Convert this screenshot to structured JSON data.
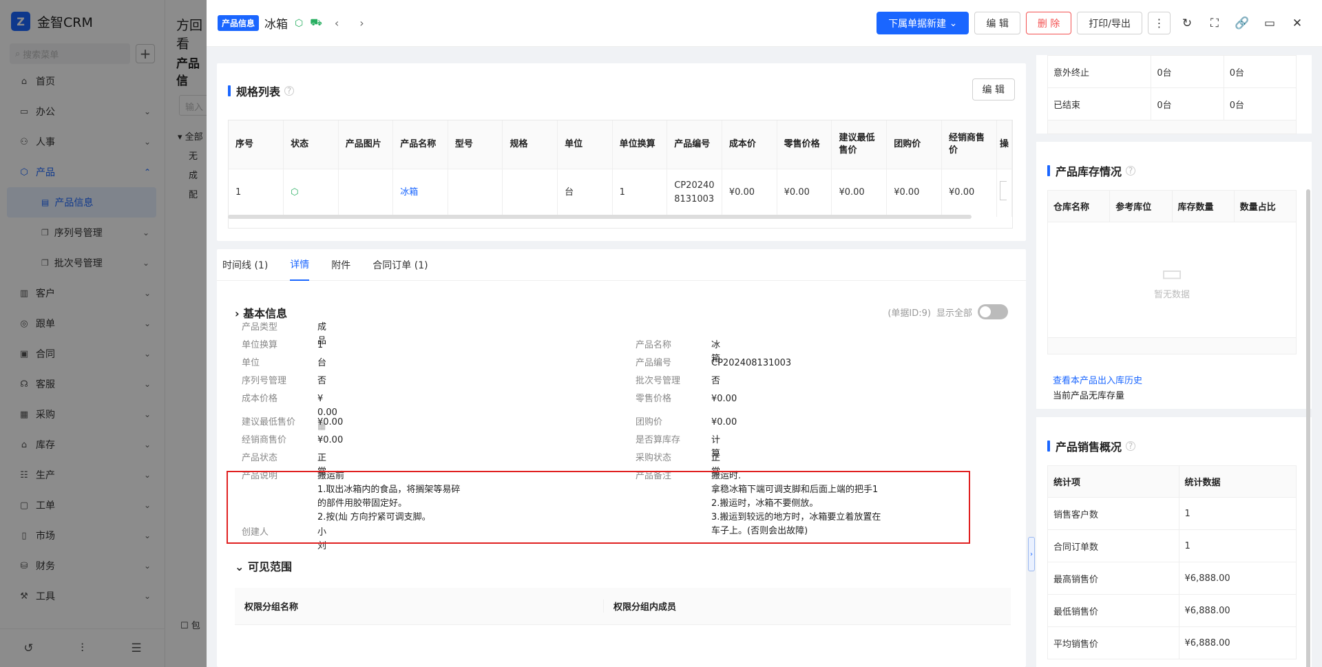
{
  "sidebar": {
    "app_name": "金智CRM",
    "search_placeholder": "搜索菜单",
    "items": [
      {
        "label": "首页",
        "icon": "home-icon"
      },
      {
        "label": "办公",
        "icon": "office-icon"
      },
      {
        "label": "人事",
        "icon": "people-icon"
      },
      {
        "label": "产品",
        "icon": "cube-icon"
      },
      {
        "label": "产品信息",
        "icon": "list-icon"
      },
      {
        "label": "序列号管理",
        "icon": "copy-icon"
      },
      {
        "label": "批次号管理",
        "icon": "copy-icon"
      },
      {
        "label": "客户",
        "icon": "chart-icon"
      },
      {
        "label": "跟单",
        "icon": "track-icon"
      },
      {
        "label": "合同",
        "icon": "contract-icon"
      },
      {
        "label": "客服",
        "icon": "service-icon"
      },
      {
        "label": "采购",
        "icon": "cart-icon"
      },
      {
        "label": "库存",
        "icon": "warehouse-icon"
      },
      {
        "label": "生产",
        "icon": "production-icon"
      },
      {
        "label": "工单",
        "icon": "ticket-icon"
      },
      {
        "label": "市场",
        "icon": "market-icon"
      },
      {
        "label": "财务",
        "icon": "finance-icon"
      },
      {
        "label": "工具",
        "icon": "tool-icon"
      }
    ]
  },
  "background_page": {
    "title": "方回看",
    "section": "产品信",
    "input": "输入",
    "tree": [
      "全部",
      "无",
      "成",
      "配"
    ],
    "checkbox": "包"
  },
  "drawer": {
    "tag": "产品信息",
    "title": "冰箱",
    "buttons": {
      "new_sub": "下属单据新建",
      "edit": "编 辑",
      "delete": "删 除",
      "print": "打印/导出"
    }
  },
  "spec": {
    "title": "规格列表",
    "edit": "编 辑",
    "headers": [
      "序号",
      "状态",
      "产品图片",
      "产品名称",
      "型号",
      "规格",
      "单位",
      "单位换算",
      "产品编号",
      "成本价",
      "零售价格",
      "建议最低售价",
      "团购价",
      "经销商售价",
      "操"
    ],
    "row": [
      "1",
      "",
      "",
      "冰箱",
      "",
      "",
      "台",
      "1",
      "CP202408131003",
      "¥0.00",
      "¥0.00",
      "¥0.00",
      "¥0.00",
      "¥0.00",
      ""
    ]
  },
  "tabs": [
    "时间线 (1)",
    "详情",
    "附件",
    "合同订单 (1)"
  ],
  "basic": {
    "title": "基本信息",
    "doc_id": "(单据ID:9)",
    "show_all": "显示全部",
    "left": [
      {
        "k": "产品类型",
        "v": "成品"
      },
      {
        "k": "单位换算",
        "v": "1"
      },
      {
        "k": "单位",
        "v": "台"
      },
      {
        "k": "序列号管理",
        "v": "否"
      },
      {
        "k": "成本价格",
        "v": "¥ 0.00"
      },
      {
        "k": "建议最低售价",
        "v": "¥0.00"
      },
      {
        "k": "经销商售价",
        "v": "¥0.00"
      },
      {
        "k": "产品状态",
        "v": "正常"
      },
      {
        "k": "产品说明",
        "v": "搬运前\n1.取出冰箱内的食品，将搁架等易碎\n的部件用胶带固定好。\n2.按(灿 方向拧紧可调支脚。"
      },
      {
        "k": "创建人",
        "v": "小刘"
      }
    ],
    "right": [
      {
        "k": "产品名称",
        "v": "冰箱"
      },
      {
        "k": "产品编号",
        "v": "CP202408131003"
      },
      {
        "k": "批次号管理",
        "v": "否"
      },
      {
        "k": "零售价格",
        "v": "¥0.00"
      },
      {
        "k": "团购价",
        "v": "¥0.00"
      },
      {
        "k": "是否算库存",
        "v": "计算"
      },
      {
        "k": "采购状态",
        "v": "正常"
      },
      {
        "k": "产品备注",
        "v": "搬运时.\n拿稳冰箱下端可调支脚和后面上端的把手1\n2.搬运时，冰箱不要侧放。\n3.搬运到较远的地方时，冰箱要立着放置在\n车子上。(否则会出故障)"
      }
    ]
  },
  "visible": {
    "title": "可见范围",
    "col1": "权限分组名称",
    "col2": "权限分组内成员"
  },
  "status_table": [
    {
      "name": "意外终止",
      "a": "0台",
      "b": "0台"
    },
    {
      "name": "已结束",
      "a": "0台",
      "b": "0台"
    }
  ],
  "stock": {
    "title": "产品库存情况",
    "headers": [
      "仓库名称",
      "参考库位",
      "库存数量",
      "数量占比"
    ],
    "empty": "暂无数据",
    "history_link": "查看本产品出入库历史",
    "none_text": "当前产品无库存量"
  },
  "sales": {
    "title": "产品销售概况",
    "headers": [
      "统计项",
      "统计数据"
    ],
    "rows": [
      {
        "k": "销售客户数",
        "v": "1"
      },
      {
        "k": "合同订单数",
        "v": "1"
      },
      {
        "k": "最高销售价",
        "v": "¥6,888.00"
      },
      {
        "k": "最低销售价",
        "v": "¥6,888.00"
      },
      {
        "k": "平均销售价",
        "v": "¥6,888.00"
      }
    ]
  },
  "colors": {
    "accent": "#1a66ff",
    "danger": "#f35050",
    "highlight_box": "#e02020"
  }
}
